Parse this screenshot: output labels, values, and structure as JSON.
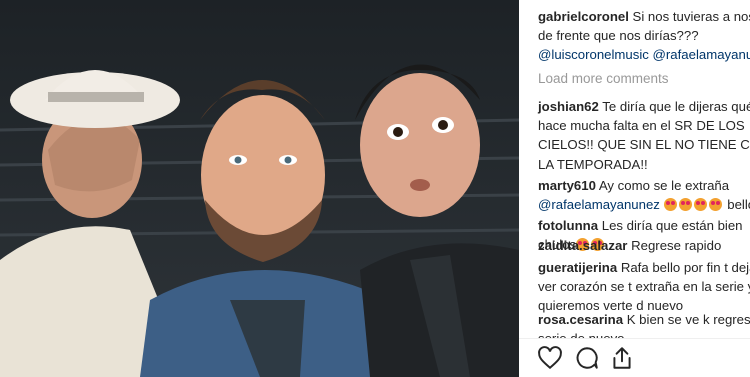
{
  "comments": [
    {
      "user": "gabrielcoronel",
      "lines": [
        "Si nos tuvieras a nosotros",
        "de frente que nos dirías???"
      ],
      "mentions": "@luiscoronelmusic @rafaelamayanunez"
    },
    {
      "user": "joshian62",
      "lines": [
        "Te diría que le dijeras qué",
        "hace mucha falta en el SR DE LOS",
        "CIELOS!! QUE SIN EL NO TIENE CHISTE",
        "LA TEMPORADA!!"
      ]
    },
    {
      "user": "marty610",
      "lines": [
        "Ay como se le extraña"
      ],
      "mentions": "@rafaelamayanunez",
      "tail": "bellos"
    },
    {
      "user": "fotolunna",
      "lines": [
        "Les diría que están bien",
        "chulos"
      ]
    },
    {
      "user": "zaidita.salazar",
      "lines": [
        "Regrese rapido"
      ]
    },
    {
      "user": "gueratijerina",
      "lines": [
        "Rafa bello por fin t dejas",
        "ver corazón se t extraña en la serie ya",
        "quieremos verte d nuevo"
      ]
    },
    {
      "user": "rosa.cesarina",
      "lines": [
        "K bien se ve k regrese ala",
        "serie de nuevo"
      ]
    }
  ],
  "load_more": "Load more comments",
  "actions": {
    "like_icon": "heart-icon",
    "comment_icon": "comment-icon",
    "share_icon": "share-icon"
  },
  "colors": {
    "mention": "#003569",
    "username": "#262626",
    "muted": "#999999"
  }
}
